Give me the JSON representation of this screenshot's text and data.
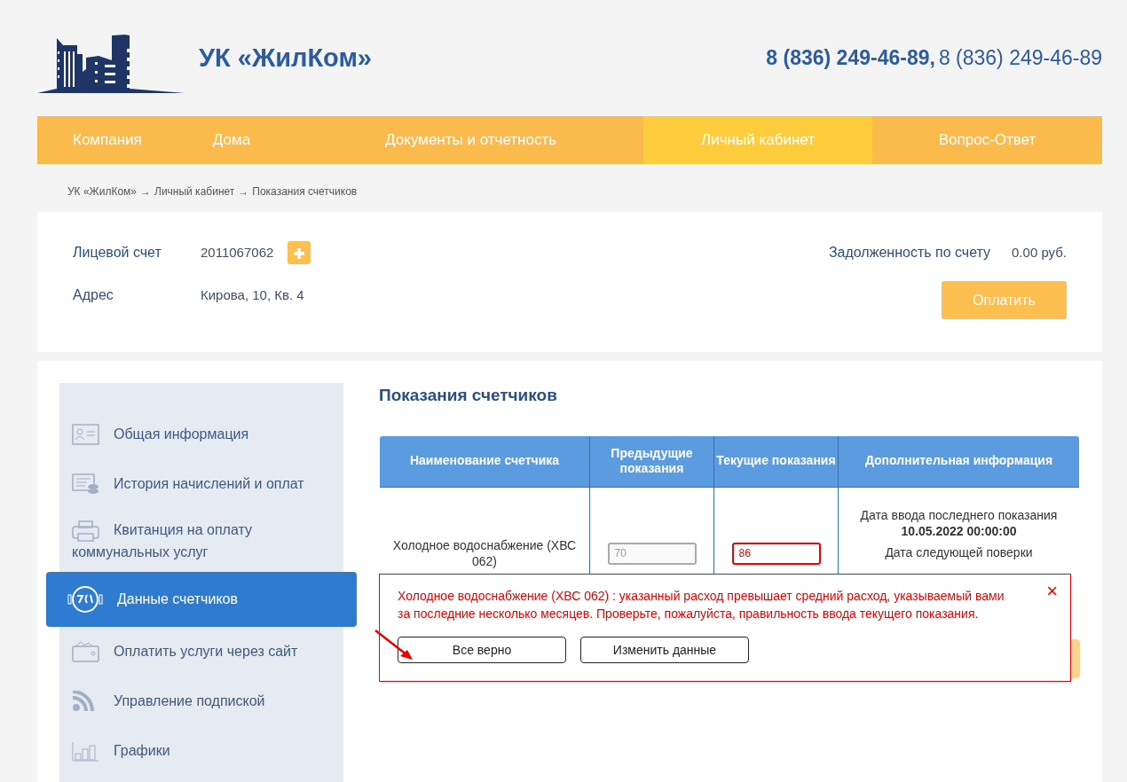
{
  "header": {
    "logo_text": "УК «ЖилКом»",
    "phones": [
      {
        "number": "8 (836) 249-46-89,",
        "bold": true
      },
      {
        "number": "8 (836) 249-46-89",
        "bold": false
      }
    ]
  },
  "nav": [
    {
      "label": "Компания",
      "selected": false
    },
    {
      "label": "Дома",
      "selected": false
    },
    {
      "label": "Документы и отчетность",
      "selected": false
    },
    {
      "label": "Личный кабинет",
      "selected": true
    },
    {
      "label": "Вопрос-Ответ",
      "selected": false
    }
  ],
  "breadcrumb": [
    "УК «ЖилКом»",
    "Личный кабинет",
    "Показания счетчиков"
  ],
  "breadcrumb_separator": "→",
  "account": {
    "fields": [
      {
        "label": "Лицевой счет",
        "value": "2011067062",
        "add_button": true
      },
      {
        "label": "Адрес",
        "value": "Кирова, 10, Кв. 4",
        "add_button": false
      }
    ],
    "debt_label": "Задолженность по счету",
    "debt_value": "0.00 руб.",
    "pay_button": "Оплатить"
  },
  "sidebar": {
    "items": [
      {
        "label": "Общая информация",
        "selected": false
      },
      {
        "label": "История начислений и оплат",
        "selected": false
      },
      {
        "label": "Квитанция на оплату коммунальных услуг",
        "selected": false
      },
      {
        "label": "Данные счетчиков",
        "selected": true
      },
      {
        "label": "Оплатить услуги через сайт",
        "selected": false
      },
      {
        "label": "Управление подпиской",
        "selected": false
      },
      {
        "label": "Графики",
        "selected": false
      }
    ]
  },
  "content": {
    "title": "Показания счетчиков",
    "table": {
      "columns": [
        "Наименование счетчика",
        "Предыдущие показания",
        "Текущие показания",
        "Дополнительная информация"
      ],
      "rows": [
        {
          "name": "Холодное водоснабжение (ХВС 062)",
          "previous": "70",
          "current": "86",
          "current_invalid": true,
          "info_lines": [
            {
              "text": "Дата ввода последнего показания **10.05.2022 00:00:00**"
            },
            {
              "text": "Дата следующей поверки"
            }
          ]
        }
      ]
    },
    "alert": {
      "message": "Холодное водоснабжение (ХВС 062) : указанный расход превышает средний расход, указываемый вами за последние несколько месяцев. Проверьте, пожалуйста, правильность ввода текущего показания.",
      "close": "×",
      "buttons": [
        "Все верно",
        "Изменить данные"
      ]
    }
  }
}
